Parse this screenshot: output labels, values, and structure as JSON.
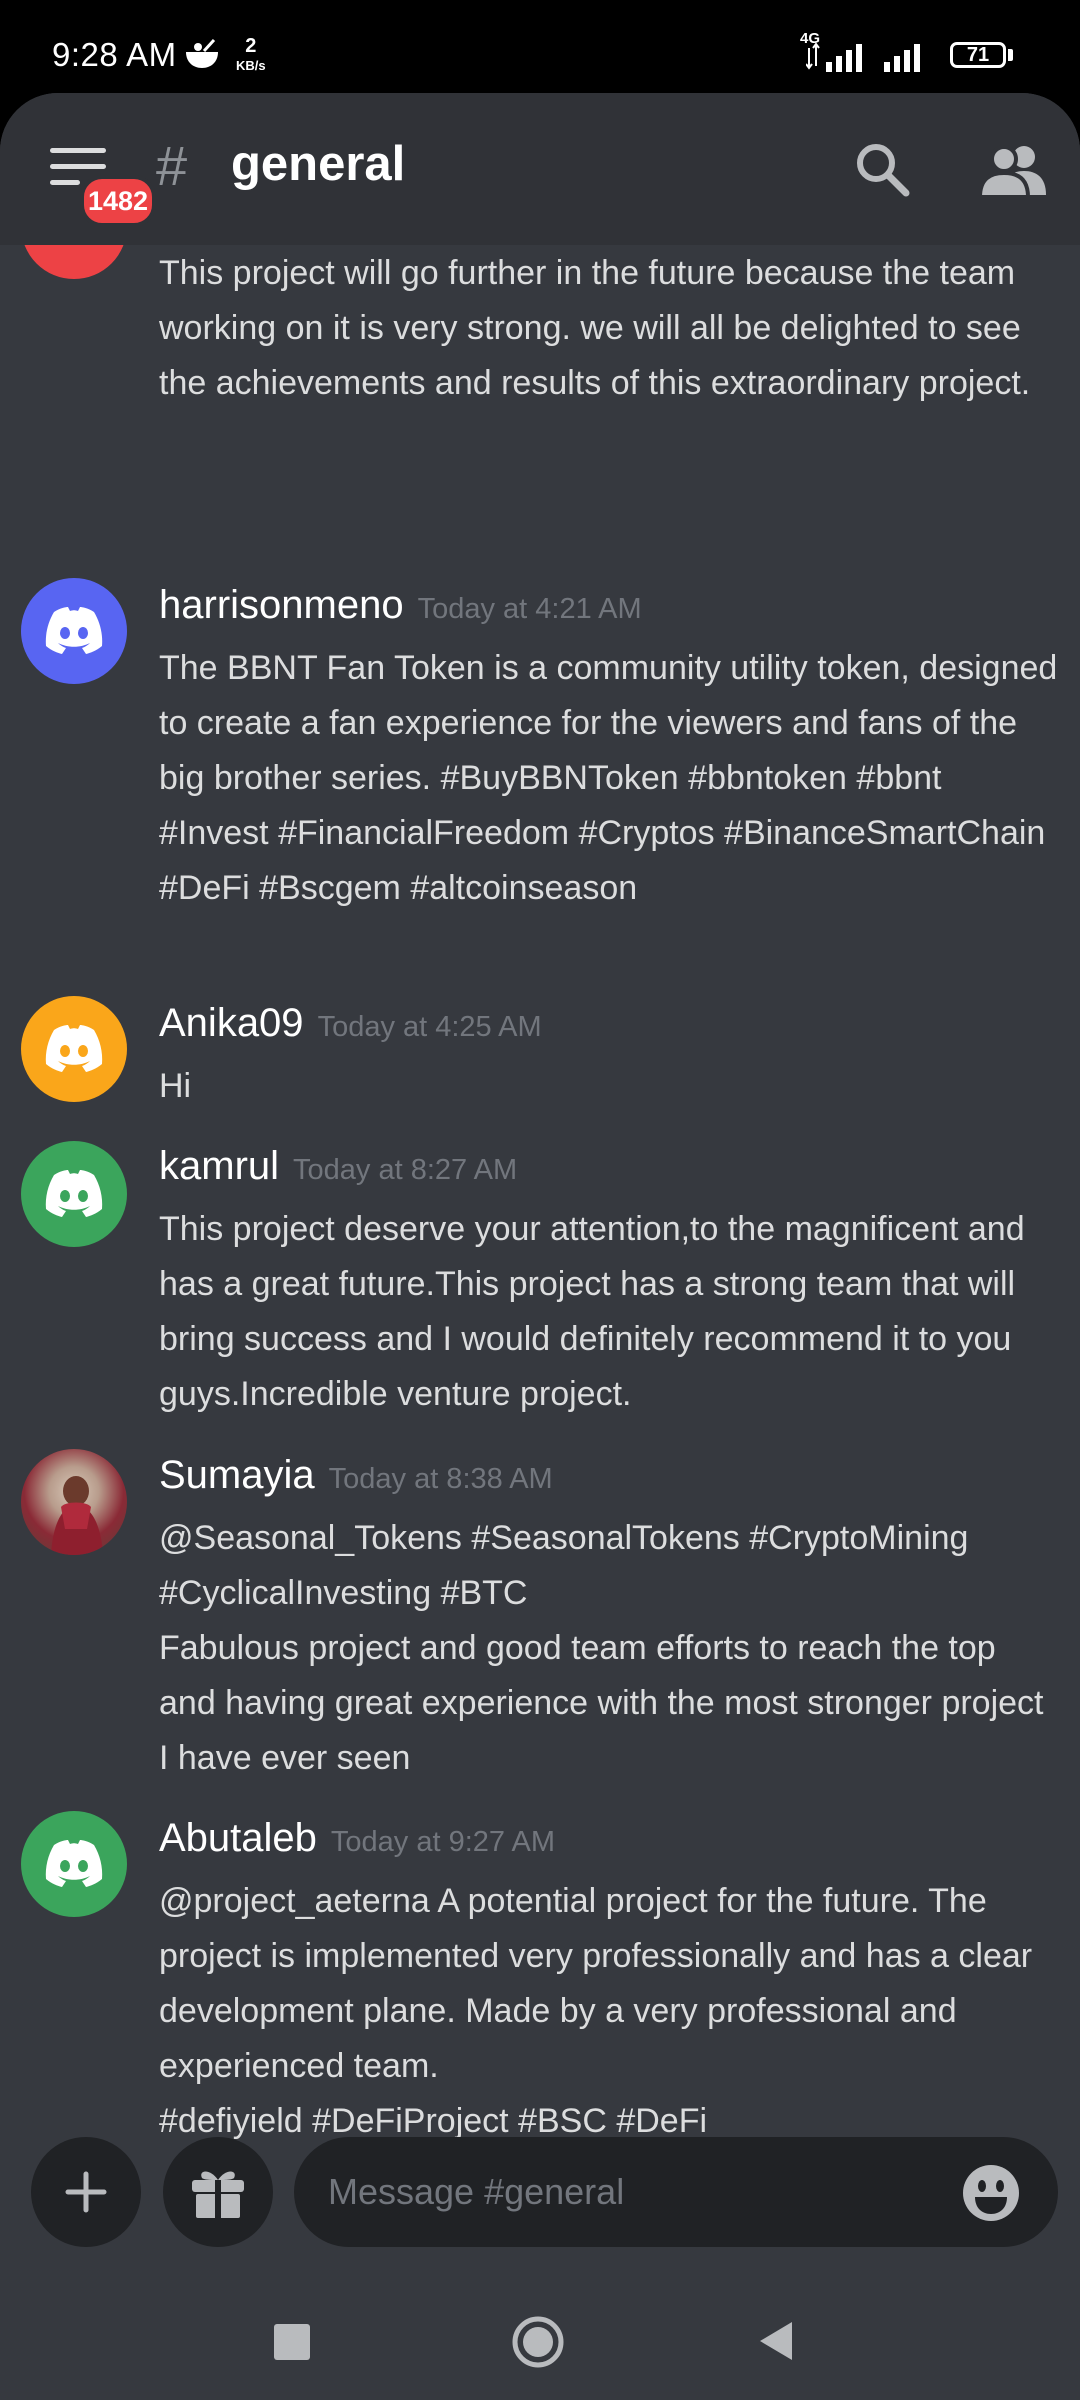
{
  "status_bar": {
    "time": "9:28 AM",
    "net_speed_value": "2",
    "net_speed_unit": "KB/s",
    "network_type": "4G",
    "battery": "71"
  },
  "header": {
    "unread_count": "1482",
    "hash": "#",
    "channel_name": "general"
  },
  "messages": [
    {
      "username": "",
      "timestamp": "",
      "avatar_color": "#ed4245",
      "text": "This project will go further in the future because the team working on it is very strong. we will all be delighted to see the achievements and results of this extraordinary project."
    },
    {
      "username": "harrisonmeno",
      "timestamp": "Today at 4:21 AM",
      "avatar_color": "#5865f2",
      "text": "The BBNT Fan Token is a community utility token, designed to create a fan experience for the viewers and fans of the big brother series.  #BuyBBNToken #bbntoken  #bbnt  #Invest #FinancialFreedom #Cryptos  #BinanceSmartChain  #DeFi  #Bscgem #altcoinseason"
    },
    {
      "username": "Anika09",
      "timestamp": "Today at 4:25 AM",
      "avatar_color": "#faa61a",
      "text": "Hi"
    },
    {
      "username": "kamrul",
      "timestamp": "Today at 8:27 AM",
      "avatar_color": "#3ba55c",
      "text": "This project deserve your attention,to the magnificent and has a great future.This project has a strong team that will bring success and  I would definitely recommend it to you guys.Incredible venture project."
    },
    {
      "username": "Sumayia",
      "timestamp": "Today at 8:38 AM",
      "avatar_color": "#8a5a4a",
      "text": "@Seasonal_Tokens #SeasonalTokens #CryptoMining #CyclicalInvesting #BTC\nFabulous project and good team efforts to reach the top and having great experience with the most stronger project I have ever seen"
    },
    {
      "username": "Abutaleb",
      "timestamp": "Today at 9:27 AM",
      "avatar_color": "#3ba55c",
      "text": "@project_aeterna A potential project for the future. The project is implemented very professionally and has a clear development plane. Made by a very professional and experienced team.\n#defiyield #DeFiProject #BSC #DeFi"
    }
  ],
  "composer": {
    "placeholder": "Message #general"
  },
  "icons": {
    "menu": "hamburger-menu-icon",
    "search": "search-icon",
    "members": "members-icon",
    "add": "plus-icon",
    "gift": "gift-icon",
    "emoji": "emoji-icon"
  },
  "colors": {
    "background": "#36393f",
    "header": "#303237",
    "input": "#202225",
    "badge": "#ed4245"
  }
}
